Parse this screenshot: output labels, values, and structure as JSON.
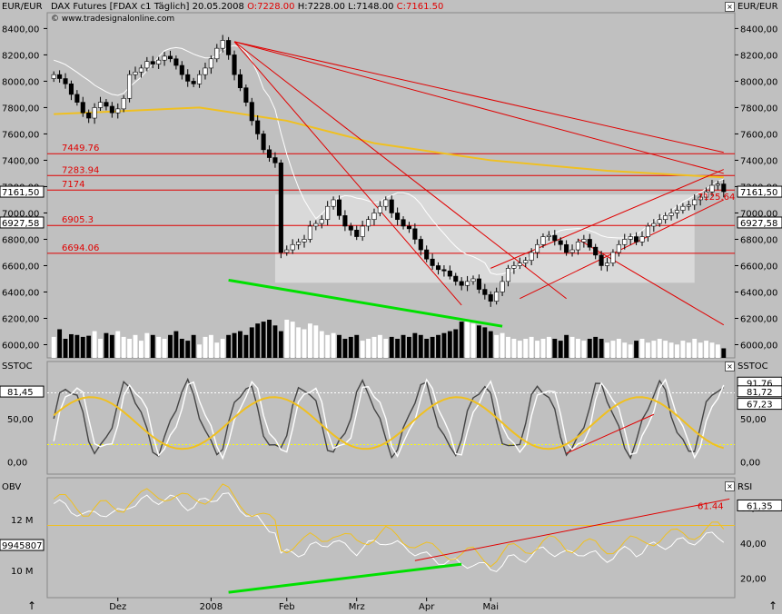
{
  "header": {
    "currency_left": "EUR/EUR",
    "currency_right": "EUR/EUR",
    "instrument": "DAX Futures [FDAX c1",
    "period": "Täglich]",
    "date": "20.05.2008",
    "open": "O:7228.00",
    "high": "H:7228.00",
    "low": "L:7148.00",
    "close": "C:7161.50",
    "copyright": "© www.tradesignalonline.com"
  },
  "chart_data": [
    {
      "type": "candlestick",
      "title": "DAX Futures [FDAX c1 Täglich]",
      "ylim": [
        5900,
        8520
      ],
      "y_ticks": [
        "8400,00",
        "8200,00",
        "8000,00",
        "7800,00",
        "7600,00",
        "7400,00",
        "7200,00",
        "7000,00",
        "6800,00",
        "6600,00",
        "6400,00",
        "6200,00",
        "6000,00"
      ],
      "y_tick_values": [
        8400,
        8200,
        8000,
        7800,
        7600,
        7400,
        7200,
        7000,
        6800,
        6600,
        6400,
        6200,
        6000
      ],
      "last_price_label": "7161,50",
      "last_price": 7161.5,
      "secondary_price_label": "6927,58",
      "secondary_price": 6927.58,
      "levels": [
        {
          "label": "7449.76",
          "value": 7449.76
        },
        {
          "label": "7283.94",
          "value": 7283.94
        },
        {
          "label": "7174",
          "value": 7174
        },
        {
          "label": "6905.3",
          "value": 6905.3
        },
        {
          "label": "6694.06",
          "value": 6694.06
        }
      ],
      "annotation": {
        "label": "7125.64",
        "value": 7125.64
      },
      "close_series": [
        8050,
        8020,
        7980,
        7900,
        7840,
        7760,
        7720,
        7800,
        7840,
        7810,
        7760,
        7790,
        7870,
        8050,
        8070,
        8100,
        8150,
        8130,
        8160,
        8190,
        8170,
        8120,
        8050,
        8000,
        7980,
        8050,
        8100,
        8170,
        8250,
        8310,
        8200,
        8050,
        7950,
        7840,
        7700,
        7600,
        7480,
        7420,
        7380,
        6700,
        6720,
        6760,
        6780,
        6800,
        6900,
        6920,
        6950,
        7050,
        7100,
        6980,
        6900,
        6870,
        6820,
        6900,
        6950,
        7000,
        7050,
        7100,
        7000,
        6950,
        6900,
        6880,
        6800,
        6720,
        6650,
        6600,
        6570,
        6560,
        6520,
        6480,
        6450,
        6480,
        6500,
        6420,
        6380,
        6330,
        6400,
        6480,
        6580,
        6600,
        6620,
        6640,
        6700,
        6760,
        6820,
        6830,
        6790,
        6760,
        6700,
        6720,
        6780,
        6800,
        6740,
        6680,
        6600,
        6620,
        6700,
        6760,
        6800,
        6820,
        6780,
        6820,
        6900,
        6920,
        6950,
        6980,
        7000,
        7020,
        7050,
        7060,
        7100,
        7120,
        7160,
        7210,
        7220,
        7161.5
      ],
      "volume": [
        0.55,
        0.75,
        0.5,
        0.62,
        0.6,
        0.55,
        0.58,
        0.7,
        0.5,
        0.65,
        0.6,
        0.7,
        0.55,
        0.5,
        0.6,
        0.45,
        0.65,
        0.6,
        0.55,
        0.5,
        0.6,
        0.7,
        0.5,
        0.45,
        0.6,
        0.35,
        0.55,
        0.6,
        0.4,
        0.5,
        0.6,
        0.65,
        0.7,
        0.6,
        0.8,
        0.9,
        0.95,
        1.0,
        0.85,
        0.7,
        1.0,
        0.95,
        0.8,
        0.75,
        0.9,
        0.85,
        0.7,
        0.6,
        0.65,
        0.6,
        0.5,
        0.55,
        0.6,
        0.45,
        0.5,
        0.55,
        0.6,
        0.5,
        0.55,
        0.5,
        0.6,
        0.55,
        0.65,
        0.6,
        0.5,
        0.55,
        0.6,
        0.65,
        0.7,
        0.75,
        0.95,
        1.0,
        0.9,
        0.85,
        0.8,
        0.7,
        0.6,
        0.65,
        0.55,
        0.5,
        0.45,
        0.5,
        0.55,
        0.45,
        0.5,
        0.55,
        0.5,
        0.45,
        0.6,
        0.55,
        0.5,
        0.45,
        0.5,
        0.55,
        0.5,
        0.4,
        0.45,
        0.5,
        0.4,
        0.35,
        0.45,
        0.5,
        0.4,
        0.45,
        0.5,
        0.45,
        0.4,
        0.35,
        0.45,
        0.4,
        0.5,
        0.4,
        0.45,
        0.4,
        0.35,
        0.25
      ]
    },
    {
      "type": "line",
      "title": "SSTOC",
      "ylim": [
        -12,
        112
      ],
      "y_ticks": [
        "50,00",
        "0,00"
      ],
      "y_tick_values": [
        50,
        0
      ],
      "left_value_label": "81,45",
      "left_value": 81.45,
      "right_value_labels": [
        "91,76",
        "81,72",
        "67,23"
      ],
      "right_values": [
        91.76,
        81.72,
        67.23
      ]
    },
    {
      "type": "line",
      "title": "OBV",
      "title_right": "RSI",
      "left_ticks": [
        "12 M",
        "10 M"
      ],
      "left_tick_values": [
        12,
        10
      ],
      "obv_value_label": "9945807",
      "obv_value": 9945807,
      "right_ticks": [
        "60,00",
        "40,00",
        "20,00"
      ],
      "right_tick_values": [
        60,
        40,
        20
      ],
      "rsi_value_label": "61,35",
      "rsi_value": 61.35,
      "annotation": {
        "label": "61.44",
        "value": 61.44
      }
    }
  ],
  "x_axis": {
    "labels": [
      "Dez",
      "2008",
      "Feb",
      "Mrz",
      "Apr",
      "Mai"
    ],
    "label_bar_index": [
      11,
      27,
      40,
      52,
      64,
      75
    ]
  },
  "colors": {
    "background": "#c0c0c0",
    "candle_up": "#ffffff",
    "candle_down": "#000000",
    "ma_yellow": "#f0c020",
    "level_red": "#e00000",
    "trend_green": "#00e000",
    "band_white": "#ffffff"
  },
  "icons": {
    "box_main": "close-box-icon",
    "arrow": "up-arrow-icon"
  }
}
